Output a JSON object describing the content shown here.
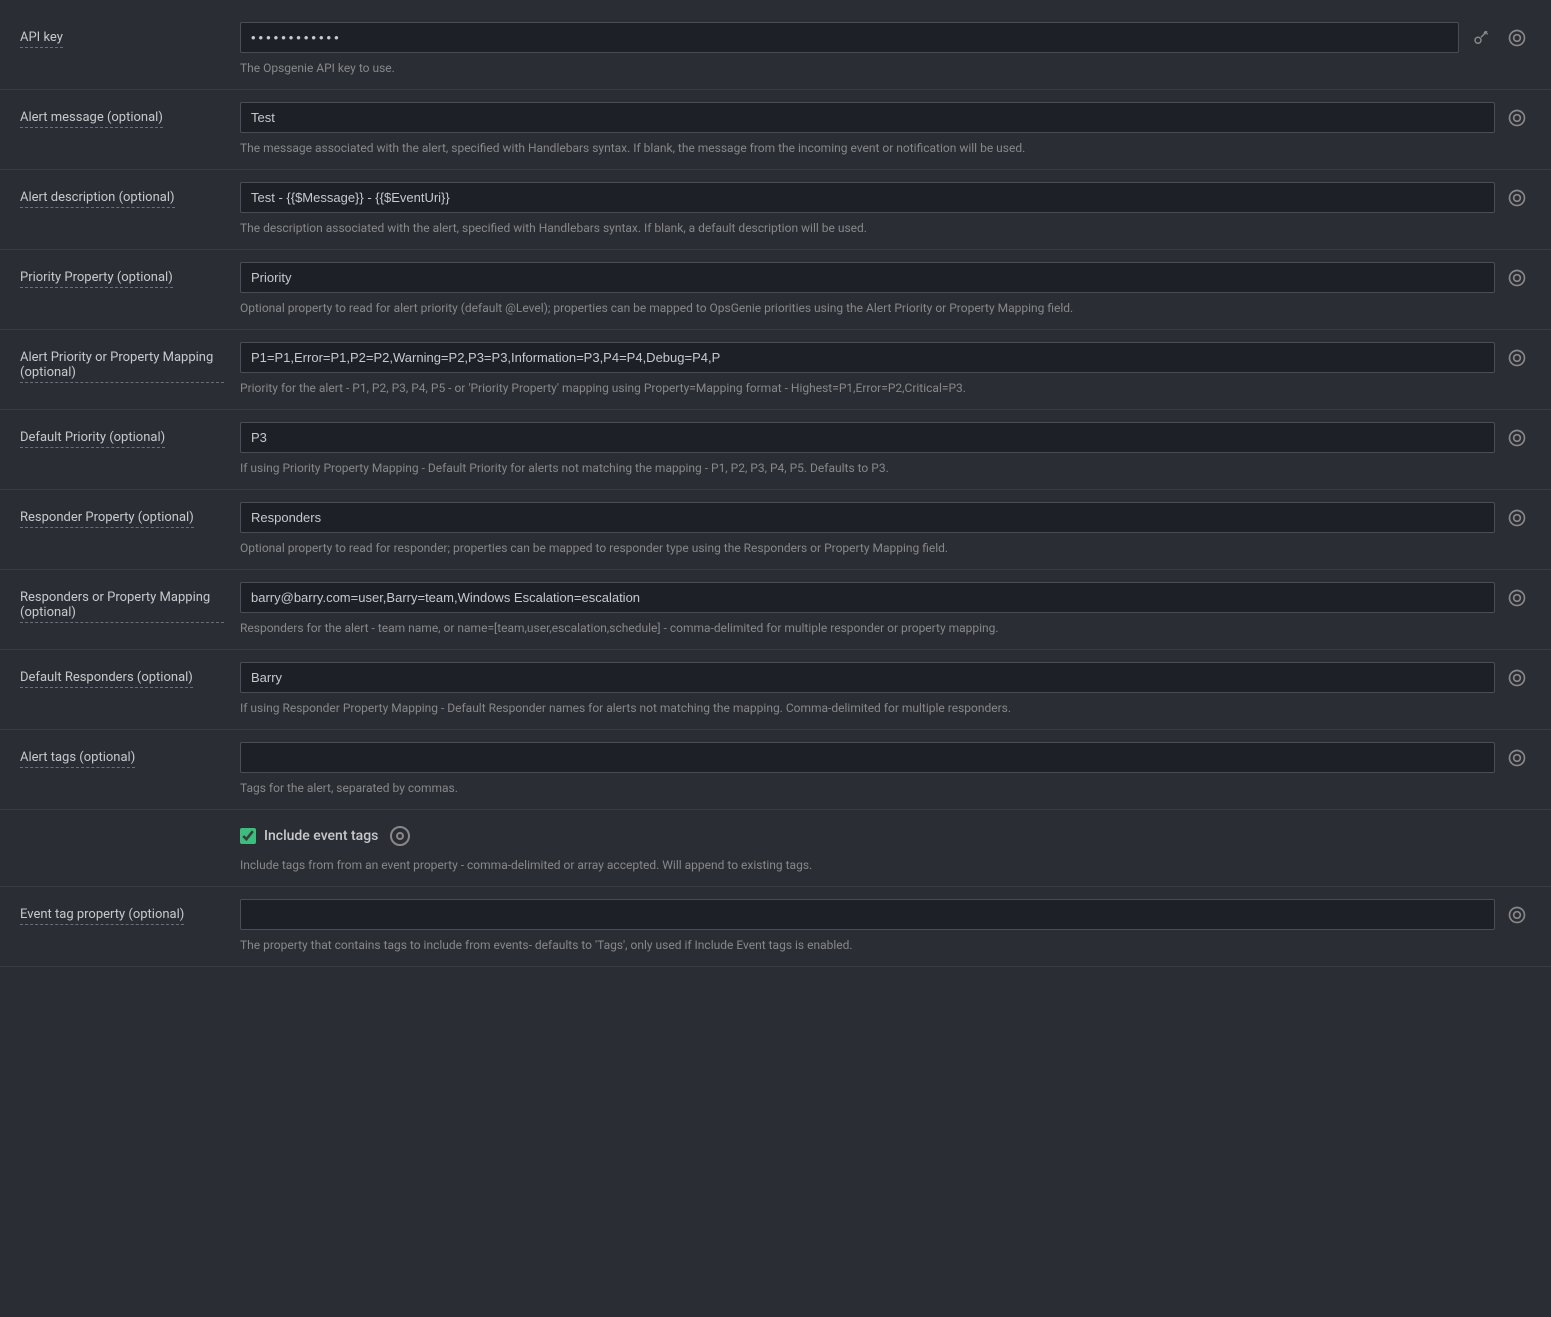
{
  "fields": [
    {
      "id": "api-key",
      "label": "API key",
      "type": "password",
      "value": "••••••••••••",
      "placeholder": "",
      "helpText": "The Opsgenie API key to use.",
      "hasRefreshIcon": false,
      "hasCopyIcon": true
    },
    {
      "id": "alert-message",
      "label": "Alert message (optional)",
      "type": "text",
      "value": "Test",
      "placeholder": "",
      "helpText": "The message associated with the alert, specified with Handlebars syntax. If blank, the message from the incoming event or notification will be used.",
      "hasRefreshIcon": false,
      "hasCopyIcon": true
    },
    {
      "id": "alert-description",
      "label": "Alert description (optional)",
      "type": "text",
      "value": "Test - {{$Message}} - {{$EventUri}}",
      "placeholder": "",
      "helpText": "The description associated with the alert, specified with Handlebars syntax. If blank, a default description will be used.",
      "hasRefreshIcon": false,
      "hasCopyIcon": true
    },
    {
      "id": "priority-property",
      "label": "Priority Property (optional)",
      "type": "text",
      "value": "Priority",
      "placeholder": "",
      "helpText": "Optional property to read for alert priority (default @Level); properties can be mapped to OpsGenie priorities using the Alert Priority or Property Mapping field.",
      "hasRefreshIcon": false,
      "hasCopyIcon": true
    },
    {
      "id": "alert-priority-mapping",
      "label": "Alert Priority or Property Mapping (optional)",
      "type": "text",
      "value": "P1=P1,Error=P1,P2=P2,Warning=P2,P3=P3,Information=P3,P4=P4,Debug=P4,P",
      "placeholder": "",
      "helpText": "Priority for the alert - P1, P2, P3, P4, P5 - or 'Priority Property' mapping using Property=Mapping format - Highest=P1,Error=P2,Critical=P3.",
      "hasRefreshIcon": false,
      "hasCopyIcon": true
    },
    {
      "id": "default-priority",
      "label": "Default Priority (optional)",
      "type": "text",
      "value": "P3",
      "placeholder": "",
      "helpText": "If using Priority Property Mapping - Default Priority for alerts not matching the mapping - P1, P2, P3, P4, P5. Defaults to P3.",
      "hasRefreshIcon": false,
      "hasCopyIcon": true
    },
    {
      "id": "responder-property",
      "label": "Responder Property (optional)",
      "type": "text",
      "value": "Responders",
      "placeholder": "",
      "helpText": "Optional property to read for responder; properties can be mapped to responder type using the Responders or Property Mapping field.",
      "hasRefreshIcon": false,
      "hasCopyIcon": true
    },
    {
      "id": "responders-mapping",
      "label": "Responders or Property Mapping (optional)",
      "type": "text",
      "value": "barry@barry.com=user,Barry=team,Windows Escalation=escalation",
      "placeholder": "",
      "helpText": "Responders for the alert - team name, or name=[team,user,escalation,schedule] - comma-delimited for multiple responder or property mapping.",
      "hasRefreshIcon": false,
      "hasCopyIcon": true
    },
    {
      "id": "default-responders",
      "label": "Default Responders (optional)",
      "type": "text",
      "value": "Barry",
      "placeholder": "",
      "helpText": "If using Responder Property Mapping - Default Responder names for alerts not matching the mapping. Comma-delimited for multiple responders.",
      "hasRefreshIcon": false,
      "hasCopyIcon": true
    },
    {
      "id": "alert-tags",
      "label": "Alert tags (optional)",
      "type": "text",
      "value": "",
      "placeholder": "",
      "helpText": "Tags for the alert, separated by commas.",
      "hasRefreshIcon": false,
      "hasCopyIcon": true
    },
    {
      "id": "include-event-tags",
      "label": "",
      "type": "checkbox",
      "value": true,
      "checkboxLabel": "Include event tags",
      "placeholder": "",
      "helpText": "Include tags from from an event property - comma-delimited or array accepted. Will append to existing tags.",
      "hasRefreshIcon": false,
      "hasCopyIcon": true
    },
    {
      "id": "event-tag-property",
      "label": "Event tag property (optional)",
      "type": "text",
      "value": "",
      "placeholder": "",
      "helpText": "The property that contains tags to include from events- defaults to 'Tags', only used if Include Event tags is enabled.",
      "hasRefreshIcon": false,
      "hasCopyIcon": true
    }
  ],
  "icons": {
    "copy": "⊙",
    "refresh": "⊙"
  }
}
